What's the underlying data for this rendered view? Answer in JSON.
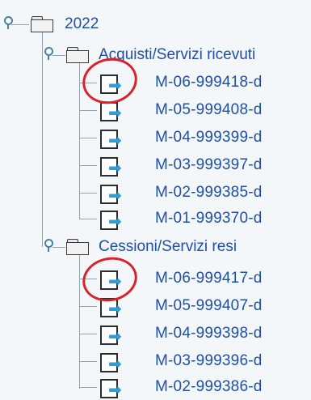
{
  "tree": {
    "root": {
      "label": "2022",
      "expanded": true
    },
    "groups": [
      {
        "label": "Acquisti/Servizi ricevuti",
        "expanded": true,
        "items": [
          "M-06-999418-d",
          "M-05-999408-d",
          "M-04-999399-d",
          "M-03-999397-d",
          "M-02-999385-d",
          "M-01-999370-d"
        ]
      },
      {
        "label": "Cessioni/Servizi resi",
        "expanded": true,
        "items": [
          "M-06-999417-d",
          "M-05-999407-d",
          "M-04-999398-d",
          "M-03-999396-d",
          "M-02-999386-d"
        ]
      }
    ],
    "doc_icon": "document-export-icon",
    "folder_icon": "folder-icon",
    "highlight_color": "#d9222a"
  }
}
